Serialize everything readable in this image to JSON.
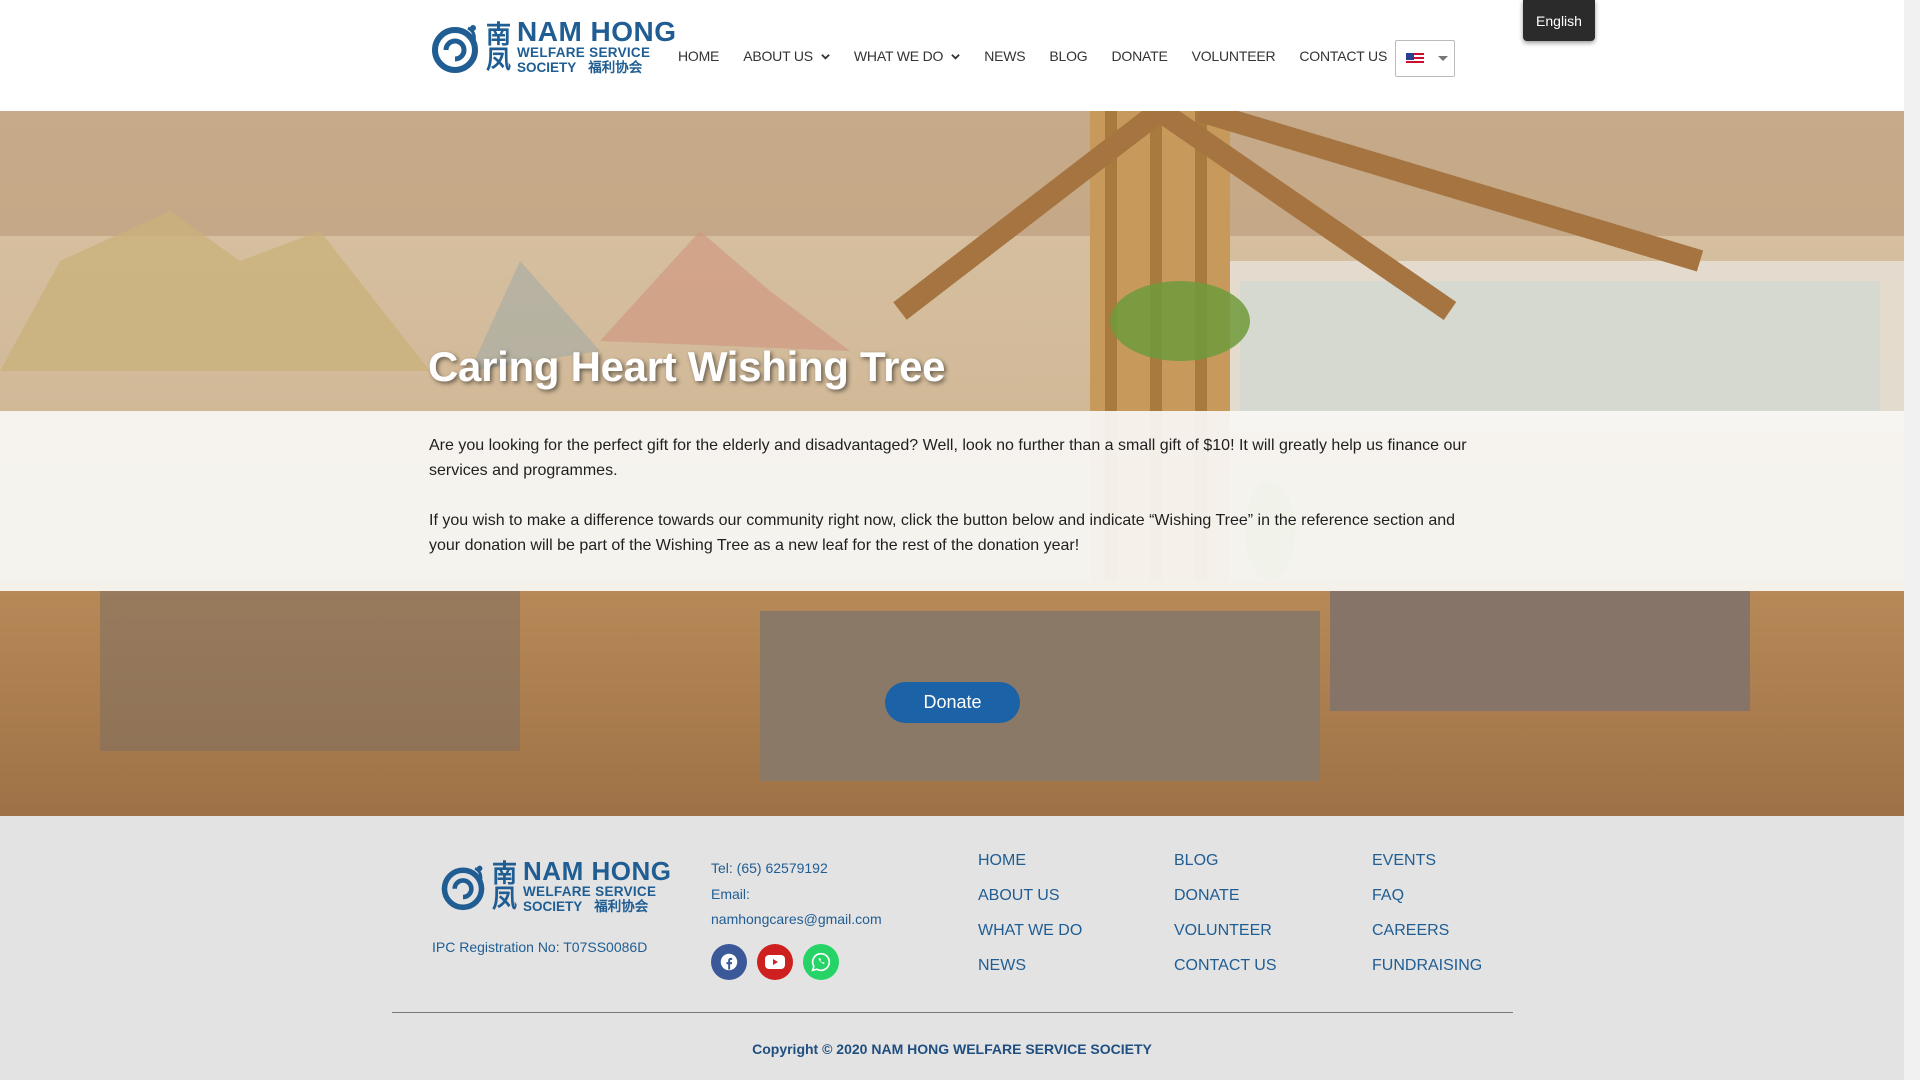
{
  "header": {
    "logo": {
      "cn_top": "南",
      "cn_bottom": "凤",
      "name": "NAM HONG",
      "sub1": "WELFARE SERVICE",
      "sub2": "SOCIETY",
      "sub2_cn": "福利协会"
    },
    "nav": [
      {
        "label": "HOME",
        "dropdown": false
      },
      {
        "label": "ABOUT US",
        "dropdown": true
      },
      {
        "label": "WHAT WE DO",
        "dropdown": true
      },
      {
        "label": "NEWS",
        "dropdown": false
      },
      {
        "label": "BLOG",
        "dropdown": false
      },
      {
        "label": "DONATE",
        "dropdown": false
      },
      {
        "label": "VOLUNTEER",
        "dropdown": false
      },
      {
        "label": "CONTACT US",
        "dropdown": false
      }
    ],
    "language_tooltip": "English",
    "language_flag": "us-flag-icon"
  },
  "hero": {
    "title": "Caring Heart Wishing Tree",
    "paragraph1": "Are you looking for the perfect gift for the elderly and disadvantaged? Well, look no further than a small gift of $10! It will greatly help us finance our services and programmes.",
    "paragraph2": "If you wish to make a difference towards our community right now, click the button below and indicate “Wishing Tree” in the reference section and your donation will be part of the Wishing Tree as a new leaf for the rest of the donation year!",
    "donate_label": "Donate"
  },
  "footer": {
    "ipc": "IPC Registration No: T07SS0086D",
    "tel": "Tel: (65) 62579192",
    "email_label": "Email:",
    "email": "namhongcares@gmail.com",
    "socials": [
      "facebook-icon",
      "youtube-icon",
      "whatsapp-icon"
    ],
    "col1": [
      "HOME",
      "ABOUT US",
      "WHAT WE DO",
      "NEWS"
    ],
    "col2": [
      "BLOG",
      "DONATE",
      "VOLUNTEER",
      "CONTACT US"
    ],
    "col3": [
      "EVENTS",
      "FAQ",
      "CAREERS",
      "FUNDRAISING"
    ],
    "copyright": "Copyright © 2020 NAM HONG WELFARE SERVICE SOCIETY"
  },
  "colors": {
    "brand_blue": "#1f5d93",
    "button_blue": "#1c62a6",
    "footer_bg": "#e3e3e3"
  }
}
